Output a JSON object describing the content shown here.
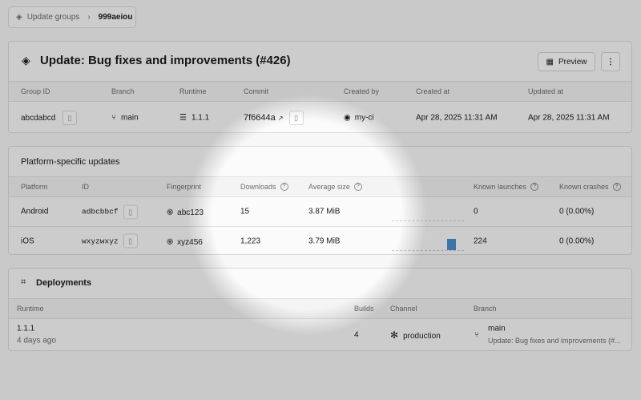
{
  "breadcrumb": {
    "parent": "Update groups",
    "current": "999aeiou"
  },
  "update": {
    "title": "Update: Bug fixes and improvements (#426)",
    "preview_label": "Preview",
    "columns": [
      "Group ID",
      "Branch",
      "Runtime",
      "Commit",
      "Created by",
      "Created at",
      "Updated at"
    ],
    "values": {
      "group_id": "abcdabcd",
      "branch": "main",
      "runtime": "1.1.1",
      "commit": "7f6644a",
      "created_by": "my-ci",
      "created_at": "Apr 28, 2025 11:31 AM",
      "updated_at": "Apr 28, 2025 11:31 AM"
    }
  },
  "platforms": {
    "title": "Platform-specific updates",
    "columns": [
      "Platform",
      "ID",
      "Fingerprint",
      "Downloads",
      "Average size",
      "Known launches",
      "Known crashes"
    ],
    "rows": [
      {
        "platform": "Android",
        "id": "adbcbbcf",
        "fingerprint": "abc123",
        "downloads": "15",
        "avg_size": "3.87 MiB",
        "launches": "0",
        "crashes": "0 (0.00%)",
        "chart_level": 0
      },
      {
        "platform": "iOS",
        "id": "wxyzwxyz",
        "fingerprint": "xyz456",
        "downloads": "1,223",
        "avg_size": "3.79 MiB",
        "launches": "224",
        "crashes": "0 (0.00%)",
        "chart_level": 1
      }
    ]
  },
  "deployments": {
    "title": "Deployments",
    "columns": [
      "Runtime",
      "Builds",
      "Channel",
      "Branch"
    ],
    "rows": [
      {
        "runtime": "1.1.1",
        "age": "4 days ago",
        "builds": "4",
        "channel": "production",
        "branch": "main",
        "message": "Update: Bug fixes and improvements (#..."
      }
    ]
  },
  "colors": {
    "accent": "#4a90d0"
  }
}
